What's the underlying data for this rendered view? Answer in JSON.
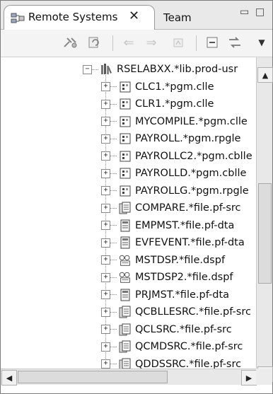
{
  "tabs": {
    "active_label": "Remote Systems",
    "close_glyph": "✕",
    "second_label": "Team",
    "minimize_glyph": "▭",
    "maximize_glyph": "□"
  },
  "toolbar": {
    "items": [
      "connect-icon",
      "refresh-icon",
      "back-icon",
      "forward-icon",
      "home-icon",
      "collapse-all-icon",
      "link-with-editor-icon",
      "view-menu-icon"
    ]
  },
  "tree": {
    "root": {
      "label": "RSELABXX.*lib.prod-usr",
      "expander": "−",
      "icon": "library-icon"
    },
    "children": [
      {
        "label": "CLC1.*pgm.clle",
        "icon": "program-icon"
      },
      {
        "label": "CLR1.*pgm.clle",
        "icon": "program-icon"
      },
      {
        "label": "MYCOMPILE.*pgm.clle",
        "icon": "program-icon"
      },
      {
        "label": "PAYROLL.*pgm.rpgle",
        "icon": "program-icon"
      },
      {
        "label": "PAYROLLC2.*pgm.cblle",
        "icon": "program-icon"
      },
      {
        "label": "PAYROLLD.*pgm.cblle",
        "icon": "program-icon"
      },
      {
        "label": "PAYROLLG.*pgm.rpgle",
        "icon": "program-icon"
      },
      {
        "label": "COMPARE.*file.pf-src",
        "icon": "source-file-icon"
      },
      {
        "label": "EMPMST.*file.pf-dta",
        "icon": "data-file-icon"
      },
      {
        "label": "EVFEVENT.*file.pf-dta",
        "icon": "data-file-icon"
      },
      {
        "label": "MSTDSP.*file.dspf",
        "icon": "display-file-icon"
      },
      {
        "label": "MSTDSP2.*file.dspf",
        "icon": "display-file-icon"
      },
      {
        "label": "PRJMST.*file.pf-dta",
        "icon": "data-file-icon"
      },
      {
        "label": "QCBLLESRC.*file.pf-src",
        "icon": "source-file-icon"
      },
      {
        "label": "QCLSRC.*file.pf-src",
        "icon": "source-file-icon"
      },
      {
        "label": "QCMDSRC.*file.pf-src",
        "icon": "source-file-icon"
      },
      {
        "label": "QDDSSRC.*file.pf-src",
        "icon": "source-file-icon"
      }
    ],
    "expander_glyph": "+"
  },
  "scrollbars": {
    "up": "▲",
    "down": "▼",
    "left": "◀",
    "right": "▶"
  }
}
